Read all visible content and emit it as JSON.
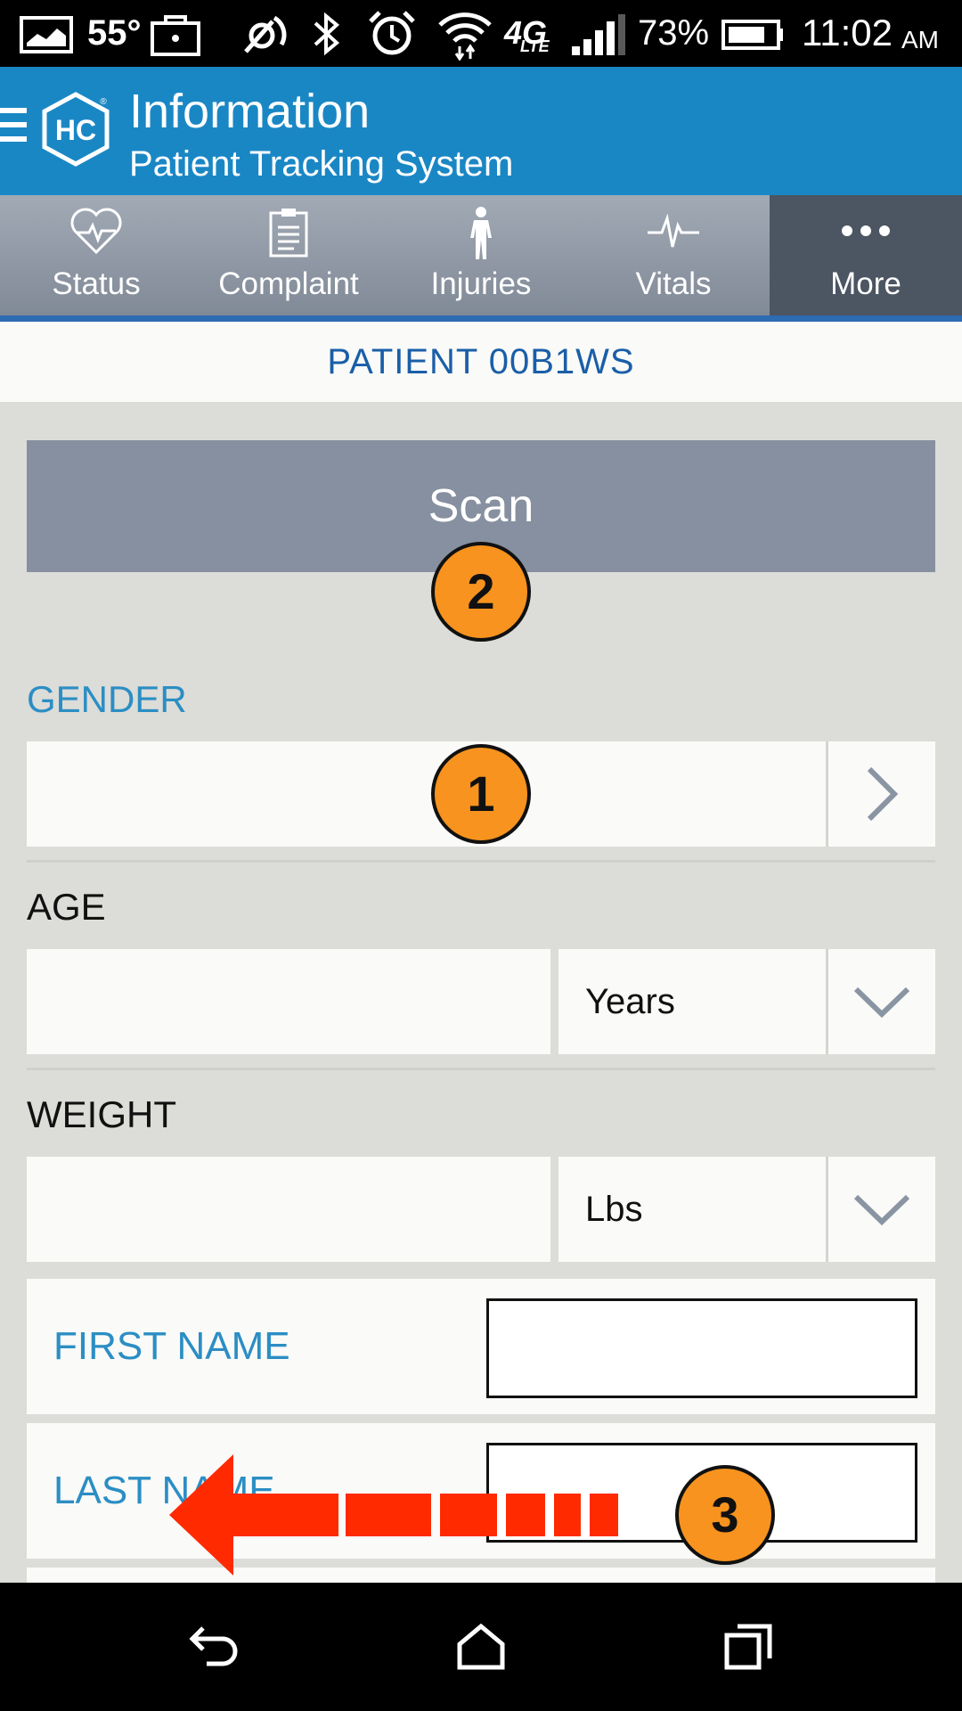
{
  "status_bar": {
    "temperature": "55°",
    "battery_percent": "73%",
    "time": "11:02",
    "ampm": "AM",
    "network": "4G",
    "network_sub": "LTE",
    "icons": [
      "image-icon",
      "temperature",
      "briefcase-icon",
      "nfc-icon",
      "bluetooth-icon",
      "alarm-icon",
      "wifi-icon",
      "lte-icon",
      "signal-icon",
      "battery-icon"
    ]
  },
  "app_bar": {
    "title": "Information",
    "subtitle": "Patient Tracking System",
    "logo_text": "HC",
    "logo_registered": "®",
    "color": "#1a87c5"
  },
  "tabs": [
    {
      "label": "Status",
      "icon": "heart-pulse-icon",
      "active": false
    },
    {
      "label": "Complaint",
      "icon": "clipboard-icon",
      "active": false
    },
    {
      "label": "Injuries",
      "icon": "body-icon",
      "active": false
    },
    {
      "label": "Vitals",
      "icon": "pulse-icon",
      "active": false
    },
    {
      "label": "More",
      "icon": "more-dots-icon",
      "active": true
    }
  ],
  "patient": {
    "header": "PATIENT 00B1WS"
  },
  "scan": {
    "label": "Scan"
  },
  "gender": {
    "label": "GENDER",
    "value": ""
  },
  "age": {
    "label": "AGE",
    "value": "",
    "unit": "Years"
  },
  "weight": {
    "label": "WEIGHT",
    "value": "",
    "unit": "Lbs"
  },
  "first_name": {
    "label": "FIRST NAME",
    "value": ""
  },
  "last_name": {
    "label": "LAST NAME",
    "value": ""
  },
  "annotations": {
    "marker1": "1",
    "marker2": "2",
    "marker3": "3",
    "arrow_color": "#ff2a00",
    "marker_color": "#f7931e"
  },
  "nav_bar": {
    "buttons": [
      "back-icon",
      "home-icon",
      "recents-icon"
    ]
  }
}
